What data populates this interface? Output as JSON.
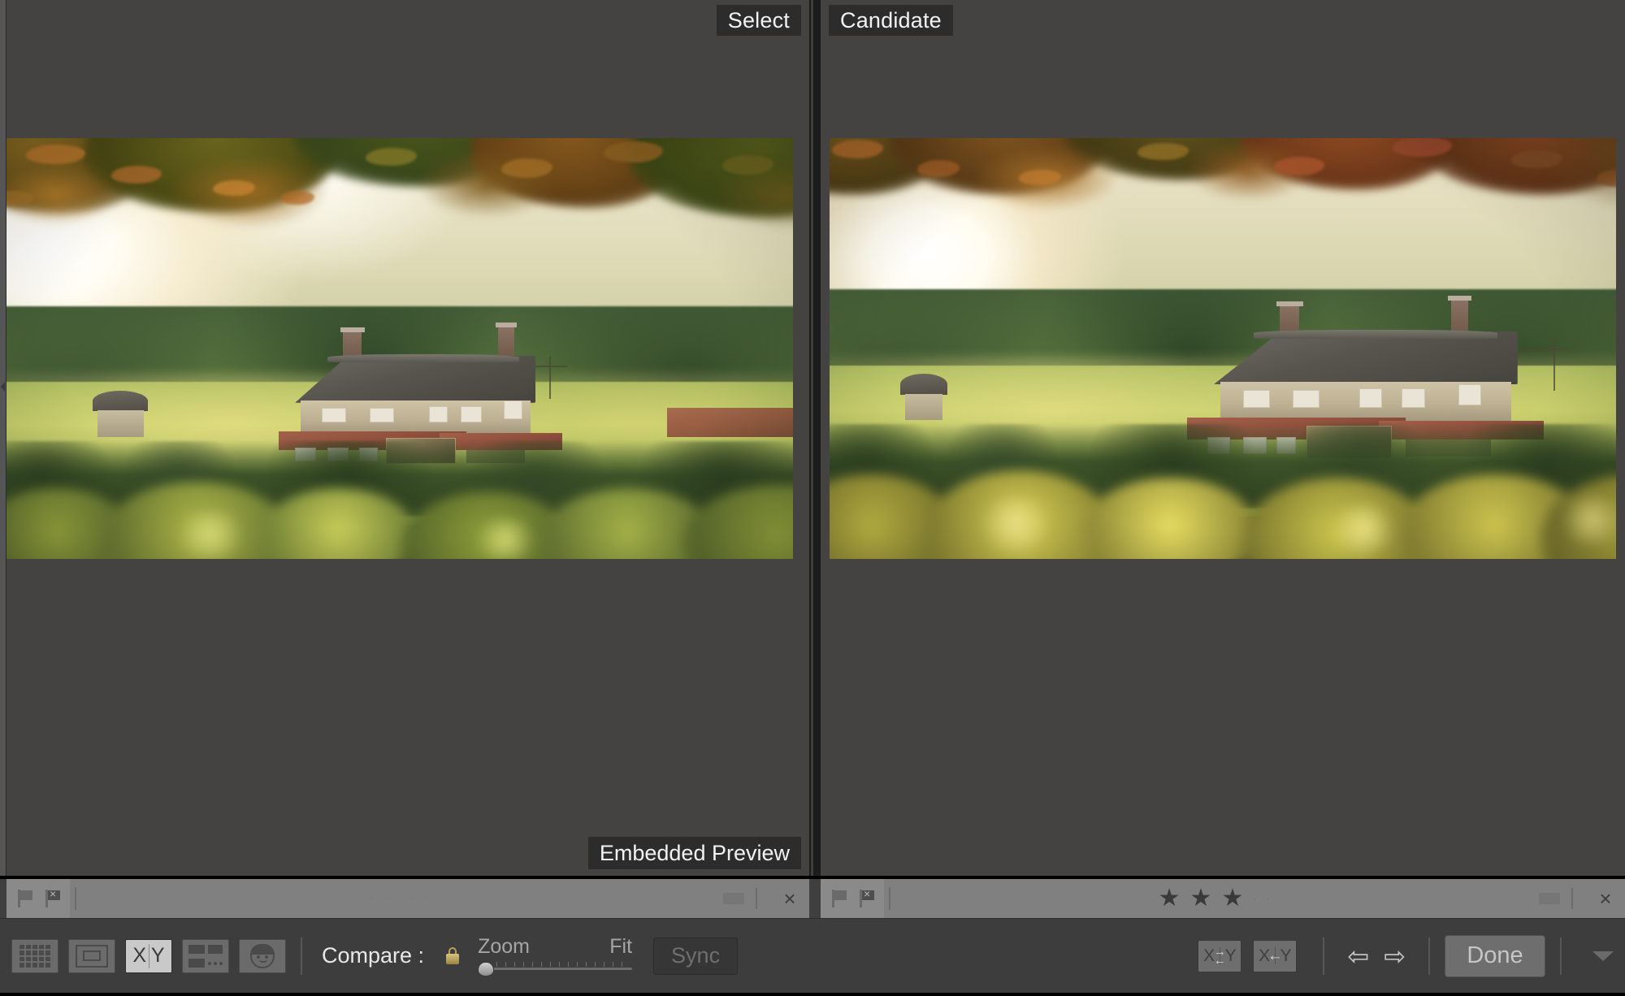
{
  "app": {
    "module": "Library",
    "view_mode": "Compare"
  },
  "panes": {
    "select": {
      "label": "Select",
      "badge": "Embedded Preview",
      "photo": {
        "subject": "thatched cottage in sunlit valley framed by autumn beech leaves",
        "rating": 0,
        "flag": "none"
      }
    },
    "candidate": {
      "label": "Candidate",
      "photo": {
        "subject": "thatched cottage wider view with golden foreground foliage",
        "rating": 3,
        "flag": "none"
      }
    }
  },
  "infobar": {
    "flag_pick": "pick-flag",
    "flag_reject": "reject-flag",
    "close": "×",
    "star_filled": "★",
    "star_empty": "·",
    "left_stars": [
      "·",
      "·",
      "·",
      "·",
      "·"
    ],
    "right_stars": [
      "★",
      "★",
      "★",
      "·",
      "·"
    ]
  },
  "toolbar": {
    "view_buttons": [
      {
        "name": "grid-view",
        "icon": "grid-icon",
        "active": false
      },
      {
        "name": "loupe-view",
        "icon": "loupe-icon",
        "active": false
      },
      {
        "name": "compare-view",
        "icon": "compare-xy-icon",
        "active": true,
        "x_label": "X",
        "y_label": "Y"
      },
      {
        "name": "survey-view",
        "icon": "survey-icon",
        "active": false
      },
      {
        "name": "people-view",
        "icon": "face-icon",
        "active": false
      }
    ],
    "compare_label": "Compare :",
    "lock_icon": "lock-closed-icon",
    "zoom_label": "Zoom",
    "fit_label": "Fit",
    "zoom_value": 0,
    "sync_label": "Sync",
    "sync_enabled": false,
    "swap_button": {
      "name": "swap-select-candidate",
      "x": "X",
      "y": "Y",
      "arrow_top": "→",
      "arrow_bottom": "←"
    },
    "make_select_button": {
      "name": "make-candidate-select",
      "x": "X",
      "y": "Y",
      "arrow": "←"
    },
    "prev_arrow": "⇦",
    "next_arrow": "⇨",
    "done_label": "Done",
    "dropdown_icon": "chevron-down-icon"
  },
  "colors": {
    "background": "#3f3f3f",
    "pane_background": "#444342",
    "toolbar_background": "#3d3d3d",
    "infobar_background": "#808080",
    "label_background": "#2c2c2c",
    "label_text": "#f2f2f2",
    "active_button": "#c9c9c9",
    "disabled_text": "#6f6f6f"
  }
}
